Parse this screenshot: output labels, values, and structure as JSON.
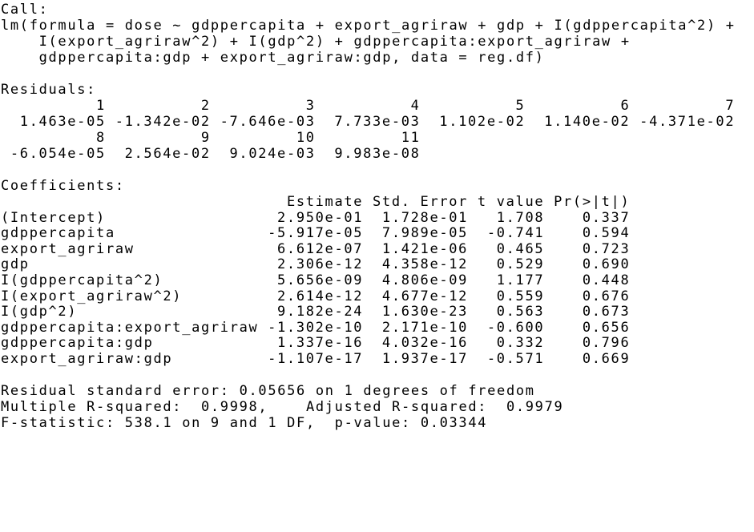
{
  "call": {
    "label": "Call:",
    "lines": [
      "lm(formula = dose ~ gdppercapita + export_agriraw + gdp + I(gdppercapita^2) +",
      "    I(export_agriraw^2) + I(gdp^2) + gdppercapita:export_agriraw +",
      "    gdppercapita:gdp + export_agriraw:gdp, data = reg.df)"
    ]
  },
  "residuals": {
    "label": "Residuals:",
    "blocks": [
      {
        "idx": [
          "1",
          "2",
          "3",
          "4",
          "5",
          "6",
          "7"
        ],
        "vals": [
          "1.463e-05",
          "-1.342e-02",
          "-7.646e-03",
          "7.733e-03",
          "1.102e-02",
          "1.140e-02",
          "-4.371e-02"
        ]
      },
      {
        "idx": [
          "8",
          "9",
          "10",
          "11"
        ],
        "vals": [
          "-6.054e-05",
          "2.564e-02",
          "9.024e-03",
          "9.983e-08"
        ]
      }
    ]
  },
  "coefficients": {
    "label": "Coefficients:",
    "headers": [
      "Estimate",
      "Std. Error",
      "t value",
      "Pr(>|t|)"
    ],
    "rows": [
      {
        "name": "(Intercept)",
        "est": "2.950e-01",
        "se": "1.728e-01",
        "t": "1.708",
        "p": "0.337"
      },
      {
        "name": "gdppercapita",
        "est": "-5.917e-05",
        "se": "7.989e-05",
        "t": "-0.741",
        "p": "0.594"
      },
      {
        "name": "export_agriraw",
        "est": "6.612e-07",
        "se": "1.421e-06",
        "t": "0.465",
        "p": "0.723"
      },
      {
        "name": "gdp",
        "est": "2.306e-12",
        "se": "4.358e-12",
        "t": "0.529",
        "p": "0.690"
      },
      {
        "name": "I(gdppercapita^2)",
        "est": "5.656e-09",
        "se": "4.806e-09",
        "t": "1.177",
        "p": "0.448"
      },
      {
        "name": "I(export_agriraw^2)",
        "est": "2.614e-12",
        "se": "4.677e-12",
        "t": "0.559",
        "p": "0.676"
      },
      {
        "name": "I(gdp^2)",
        "est": "9.182e-24",
        "se": "1.630e-23",
        "t": "0.563",
        "p": "0.673"
      },
      {
        "name": "gdppercapita:export_agriraw",
        "est": "-1.302e-10",
        "se": "2.171e-10",
        "t": "-0.600",
        "p": "0.656"
      },
      {
        "name": "gdppercapita:gdp",
        "est": "1.337e-16",
        "se": "4.032e-16",
        "t": "0.332",
        "p": "0.796"
      },
      {
        "name": "export_agriraw:gdp",
        "est": "-1.107e-17",
        "se": "1.937e-17",
        "t": "-0.571",
        "p": "0.669"
      }
    ]
  },
  "summary": [
    "Residual standard error: 0.05656 on 1 degrees of freedom",
    "Multiple R-squared:  0.9998,\tAdjusted R-squared:  0.9979 ",
    "F-statistic: 538.1 on 9 and 1 DF,  p-value: 0.03344"
  ]
}
